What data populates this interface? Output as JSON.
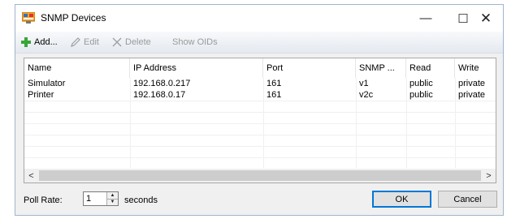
{
  "window": {
    "title": "SNMP Devices",
    "controls": {
      "minimize": "—",
      "maximize": "☐",
      "close": "✕"
    }
  },
  "toolbar": {
    "add_label": "Add...",
    "edit_label": "Edit",
    "delete_label": "Delete",
    "show_oids_label": "Show OIDs"
  },
  "table": {
    "columns": [
      "Name",
      "IP Address",
      "Port",
      "SNMP ...",
      "Read",
      "Write"
    ],
    "rows": [
      [
        "Simulator",
        "192.168.0.217",
        "161",
        "v1",
        "public",
        "private"
      ],
      [
        "Printer",
        "192.168.0.17",
        "161",
        "v2c",
        "public",
        "private"
      ]
    ]
  },
  "scrollbar": {
    "left_arrow": "<",
    "right_arrow": ">"
  },
  "footer": {
    "poll_rate_label": "Poll Rate:",
    "poll_rate_value": "1",
    "seconds_label": "seconds",
    "ok_label": "OK",
    "cancel_label": "Cancel"
  },
  "colors": {
    "accent": "#0078d7",
    "add_icon": "#3aa53a"
  }
}
